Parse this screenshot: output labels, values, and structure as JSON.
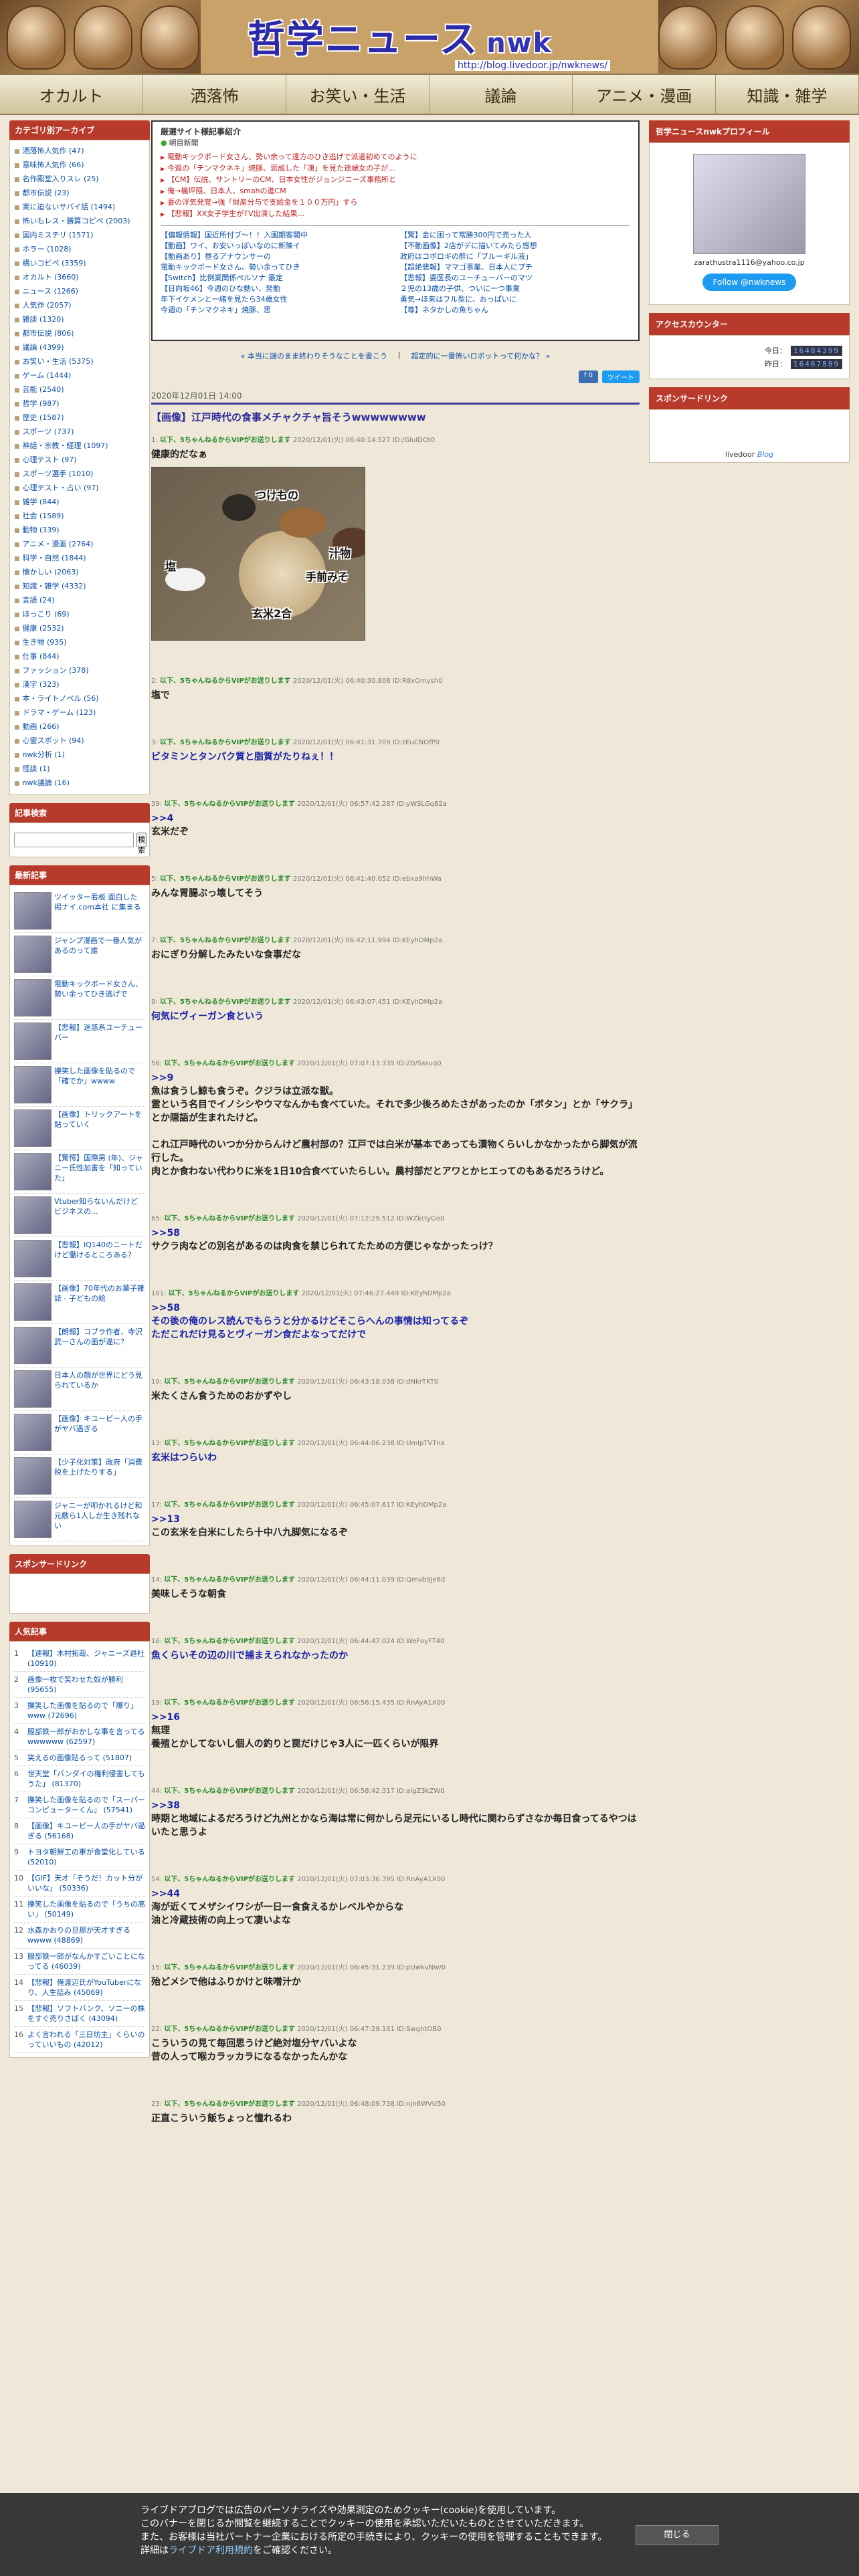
{
  "site": {
    "title": "哲学ニュース",
    "title_suffix": "nwk",
    "url": "http://blog.livedoor.jp/nwknews/"
  },
  "nav": [
    "オカルト",
    "洒落怖",
    "お笑い・生活",
    "議論",
    "アニメ・漫画",
    "知識・雑学"
  ],
  "left": {
    "category_head": "カテゴリ別アーカイブ",
    "categories": [
      "洒落怖人気作 (47)",
      "意味怖人気作 (66)",
      "名作殿堂入りスレ (25)",
      "都市伝説 (23)",
      "実に迫ないサバイ話 (1494)",
      "怖いもレス・勝算コピペ (2003)",
      "国内ミステリ (1571)",
      "ホラー (1028)",
      "構いコピペ (3359)",
      "オカルト (3660)",
      "ニュース (1266)",
      "人気作 (2057)",
      "雑談 (1320)",
      "都市伝説 (806)",
      "議論 (4399)",
      "お笑い・生活 (5375)",
      "ゲーム (1444)",
      "芸能 (2540)",
      "哲学 (987)",
      "歴史 (1587)",
      "スポーツ (737)",
      "神話・宗教・経理 (1097)",
      "心理テスト (97)",
      "スポーツ選手 (1010)",
      "心理テスト・占い (97)",
      "雑学 (844)",
      "社会 (1589)",
      "動物 (339)",
      "アニメ・漫画 (2764)",
      "科学・自然 (1844)",
      "懐かしい (2063)",
      "知識・雑学 (4332)",
      "言語 (24)",
      "ほっこり (69)",
      "健康 (2532)",
      "生き物 (935)",
      "仕事 (844)",
      "ファッション (378)",
      "漢字 (323)",
      "本・ライトノベル (56)",
      "ドラマ・ゲーム (123)",
      "動画 (266)",
      "心霊スポット (94)",
      "nwk分析 (1)",
      "怪談 (1)",
      "nwk議論 (16)"
    ],
    "search_head": "記事検索",
    "search_button": "検索",
    "recent_head": "最新記事",
    "recent": [
      "ツイッター看板 面白した 掲ナイ.com本社 に集まる",
      "ジャンプ漫画で一番人気があるのって誰",
      "電動キックボード女さん、勢い余ってひき逃げで",
      "【悲報】迷惑系ユーチューバー",
      "擽笑した画像を貼るので「確でか」wwww",
      "【画像】トリックアートを貼っていく",
      "【驚愕】国際男 (年)、ジャニー氏性加害を「知っていた」",
      "Vtuber知らないんだけど ビジネスの...",
      "【悲報】IQ140のニートだけど働けるところある？",
      "【画像】70年代のお菓子雑誌 - 子どもの絵",
      "【朗報】コブラ作者、寺沢武一さんの画が遂に？",
      "日本人の顔が世界にどう見られているか",
      "【画像】キユーピー人の手がヤバ過ぎる",
      "【少子化対策】政府「消費税を上げたりする」",
      "ジャニーが叩かれるけど和元敷ら1人しか生き残れない"
    ],
    "spon_head": "スポンサードリンク",
    "rank_head": "人気記事",
    "ranking": [
      "【速報】木村拓哉、ジャニーズ退社 (10910)",
      "画像一枚で笑わせた奴が勝利 (95655)",
      "擽笑した画像を貼るので「爆り」www (72696)",
      "服部鉄一郎がおかしな事を言ってるwwwwww (62597)",
      "笑えるの画像貼るって (51807)",
      "世天堂「バンダイの権利侵害してもうた」 (81370)",
      "擽笑した画像を貼るので「スーパーコンピューターくん」 (57541)",
      "【画像】キユーピー人の手がヤバ過ぎる (56168)",
      "トヨタ朝鮮工の車が食堂化している (52010)",
      "【GIF】天才「そうだ！カット分がいいな」 (50336)",
      "擽笑した画像を貼るので「うちの高い」 (50149)",
      "水森かおりの旦那が天才すぎるwwww (48869)",
      "服部鉄一郎がなんかすごいことになってる (46039)",
      "【悲報】俺渡辺氏がYouTuberになり、人生詰み (45069)",
      "【悲報】ソフトバンク、ソニーの株をすぐ売りさばく (43094)",
      "よく言われる「三日坊主」くらいのっていいもの (42012)"
    ]
  },
  "main": {
    "linkbox_title": "厳選サイト様記事紹介",
    "linkbox_sub": "朝目新聞",
    "links": [
      "電動キックボード女さん、勢い余って遠方のひき逃げで派遣初めてのように",
      "今週の「チンマクネキ」焼豚、思成した「凍」を見た途端女の子が...",
      "【CM】伝説、サントリーのCM、日本女性がジョンジニーズ事務所と",
      "俺→機坪限、日本人、smahの進CM",
      "妻の浮気発覚→強「財産分与で支給金を１００万円」すら",
      "【悲報】XX女子学生がTV出演した結果..."
    ],
    "grid_links": [
      "【偏報情報】国近所付ブ〜！！入園期客閣中",
      "【驚】金に困って常勝300円で売った人",
      "【動画】ワイ、お安いっぽいなのに新陳イ",
      "【不動画像】2店がデに描いてみたら感想",
      "【動画あり】昼るアナウンサーの",
      "政府はコボロギの酔に「ブルーギル液」",
      "電動キックボード女さん、勢い余ってひき",
      "【超絶悲報】ママゴ事業、日本人にプチ",
      "【Switch】比例業関係ペルソナ 最定",
      "【悲報】婆医長のユーチューバーのマツ",
      "【日向坂46】今週のひな動い、発動",
      "２児の13歳の子供、ついに一つ事業",
      "年下イケメンと一緒を見たら34歳女性",
      "勇気→ほ来はフル型に、おっぱいに",
      "今週の「チンマクネキ」焼豚、思",
      "【尊】ネタかしの魚ちゃん"
    ],
    "prev": "« 本当に謎のまま終わりそうなことを書こう",
    "next": "超定的に一番怖いロボットって何かな？ »",
    "share_fb": "0",
    "share_tw": "ツイート",
    "date": "2020年12月01日 14:00",
    "title": "【画像】江戸時代の食事メチャクチャ旨そうwwwwwwww",
    "photo_labels": [
      "つけもの",
      "汁物",
      "塩",
      "手前みそ",
      "玄米2合"
    ],
    "res": [
      {
        "head": "1: 以下、5ちゃんねるからVIPがお送りします 2020/12/01(火) 06:40:14.527 ID:/GIuIDOt0",
        "body": "健康的だなぁ",
        "blue": false,
        "photo": true
      },
      {
        "head": "2: 以下、5ちゃんねるからVIPがお送りします 2020/12/01(火) 06:40:30.808 ID:R8xOmysh0",
        "body": "塩で",
        "blue": false
      },
      {
        "head": "3: 以下、5ちゃんねるからVIPがお送りします 2020/12/01(火) 06:41:31.709 ID:zEuCNOfP0",
        "body": "ビタミンとタンパク質と脂質がたりねぇ！！",
        "blue": true
      },
      {
        "head": "39: 以下、5ちゃんねるからVIPがお送りします 2020/12/01(火) 06:57:42.287 ID:yWSLGq82a",
        "body": ">>4\n玄米だぞ",
        "blue": false
      },
      {
        "head": "5: 以下、5ちゃんねるからVIPがお送りします 2020/12/01(火) 06:41:40.052 ID:ebxa9hhWa",
        "body": "みんな胃腸ぶっ壊してそう",
        "blue": false
      },
      {
        "head": "7: 以下、5ちゃんねるからVIPがお送りします 2020/12/01(火) 06:42:11.994 ID:KEyhDMp2a",
        "body": "おにぎり分解したみたいな食事だな",
        "blue": false
      },
      {
        "head": "9: 以下、5ちゃんねるからVIPがお送りします 2020/12/01(火) 06:43:07.451 ID:KEyhDMp2a",
        "body": "何気にヴィーガン食という",
        "blue": true
      },
      {
        "head": "56: 以下、5ちゃんねるからVIPがお送りします 2020/12/01(火) 07:07:13.335 ID:Z0/Sssuq0",
        "body": ">>9\n魚は食うし鯨も食うぞ。クジラは立派な獣。\n霊という名目でイノシシやウマなんかも食べていた。それで多少後ろめたさがあったのか「ボタン」とか「サクラ」とか隠語が生まれたけど。\n\nこれ江戸時代のいつか分からんけど農村部の？江戸では白米が基本であっても漬物くらいしかなかったから脚気が流行した。\n肉とか食わない代わりに米を1日10合食べていたらしい。農村部だとアワとかヒエってのもあるだろうけど。",
        "blue": false
      },
      {
        "head": "65: 以下、5ちゃんねるからVIPがお送りします 2020/12/01(火) 07:12:29.512 ID:WZkcIyGo0",
        "body": ">>58\nサクラ肉などの別名があるのは肉食を禁じられてたための方便じゃなかったっけ？",
        "blue": false
      },
      {
        "head": "101: 以下、5ちゃんねるからVIPがお送りします 2020/12/01(火) 07:46:27.449 ID:KEyhDMp2a",
        "body": ">>58\nその後の俺のレス読んでもらうと分かるけどそこらへんの事情は知ってるぞ\nただこれだけ見るとヴィーガン食だよなってだけで",
        "blue": true
      },
      {
        "head": "10: 以下、5ちゃんねるからVIPがお送りします 2020/12/01(火) 06:43:18.038 ID:dNkrTKT0",
        "body": "米たくさん食うためのおかずやし",
        "blue": false
      },
      {
        "head": "13: 以下、5ちゃんねるからVIPがお送りします 2020/12/01(火) 06:44:06.238 ID:UmlpTVTna",
        "body": "玄米はつらいわ",
        "blue": true
      },
      {
        "head": "17: 以下、5ちゃんねるからVIPがお送りします 2020/12/01(火) 06:45:07.617 ID:KEyhDMp2a",
        "body": ">>13\nこの玄米を白米にしたら十中八九脚気になるぞ",
        "blue": false
      },
      {
        "head": "14: 以下、5ちゃんねるからVIPがお送りします 2020/12/01(火) 06:44:11.039 ID:Qmvb9Je8d",
        "body": "美味しそうな朝食",
        "blue": false
      },
      {
        "head": "16: 以下、5ちゃんねるからVIPがお送りします 2020/12/01(火) 06:44:47.024 ID:WeFoyFT40",
        "body": "魚くらいその辺の川で捕まえられなかったのか",
        "blue": true
      },
      {
        "head": "19: 以下、5ちゃんねるからVIPがお送りします 2020/12/01(火) 06:56:15.435 ID:RnAyA1X00",
        "body": ">>16\n無理\n養殖とかしてないし個人の釣りと罠だけじゃ3人に一匹くらいが限界",
        "blue": false
      },
      {
        "head": "44: 以下、5ちゃんねるからVIPがお送りします 2020/12/01(火) 06:58:42.317 ID:aigZ3kZW0",
        "body": ">>38\n時期と地域によるだろうけど九州とかなら海は常に何かしら足元にいるし時代に関わらずさなか毎日食ってるやつはいたと思うよ",
        "blue": false
      },
      {
        "head": "54: 以下、5ちゃんねるからVIPがお送りします 2020/12/01(火) 07:03:36.395 ID:RnAyA1X00",
        "body": ">>44\n海が近くてメザシイワシが一日一食食えるかレベルやからな\n油と冷蔵技術の向上って凄いよな",
        "blue": false
      },
      {
        "head": "15: 以下、5ちゃんねるからVIPがお送りします 2020/12/01(火) 06:45:31.239 ID:pUwkvNw/0",
        "body": "殆どメシで他はふりかけと味噌汁か",
        "blue": false
      },
      {
        "head": "22: 以下、5ちゃんねるからVIPがお送りします 2020/12/01(火) 06:47:29.161 ID:SwghtOB0",
        "body": "こういうの見て毎回思うけど絶対塩分ヤバいよな\n昔の人って喉カラッカラになるなかったんかな",
        "blue": false
      },
      {
        "head": "23: 以下、5ちゃんねるからVIPがお送りします 2020/12/01(火) 06:48:09.738 ID:njn6WVU50",
        "body": "正直こういう飯ちょっと憧れるわ",
        "blue": false
      }
    ]
  },
  "right": {
    "profile_head": "哲学ニュースnwkプロフィール",
    "profile_mail": "zarathustra1116@yahoo.co.jp",
    "follow": "Follow @nwknews",
    "access_head": "アクセスカウンター",
    "today_label": "今日：",
    "today_value": "16484399",
    "yesterday_label": "昨日：",
    "yesterday_value": "16467889",
    "spon_head": "スポンサードリンク",
    "livedoor": "livedoor",
    "blog": "Blog"
  },
  "cookie": {
    "line1": "ライブドアブログでは広告のパーソナライズや効果測定のためクッキー(cookie)を使用しています。",
    "line2": "このバナーを閉じるか閲覧を継続することでクッキーの使用を承認いただいたものとさせていただきます。",
    "line3": "また、お客様は当社パートナー企業における所定の手続きにより、クッキーの使用を管理することもできます。",
    "line4_prefix": "詳細は",
    "line4_link": "ライブドア利用規約",
    "line4_suffix": "をご確認ください。",
    "close": "閉じる"
  }
}
